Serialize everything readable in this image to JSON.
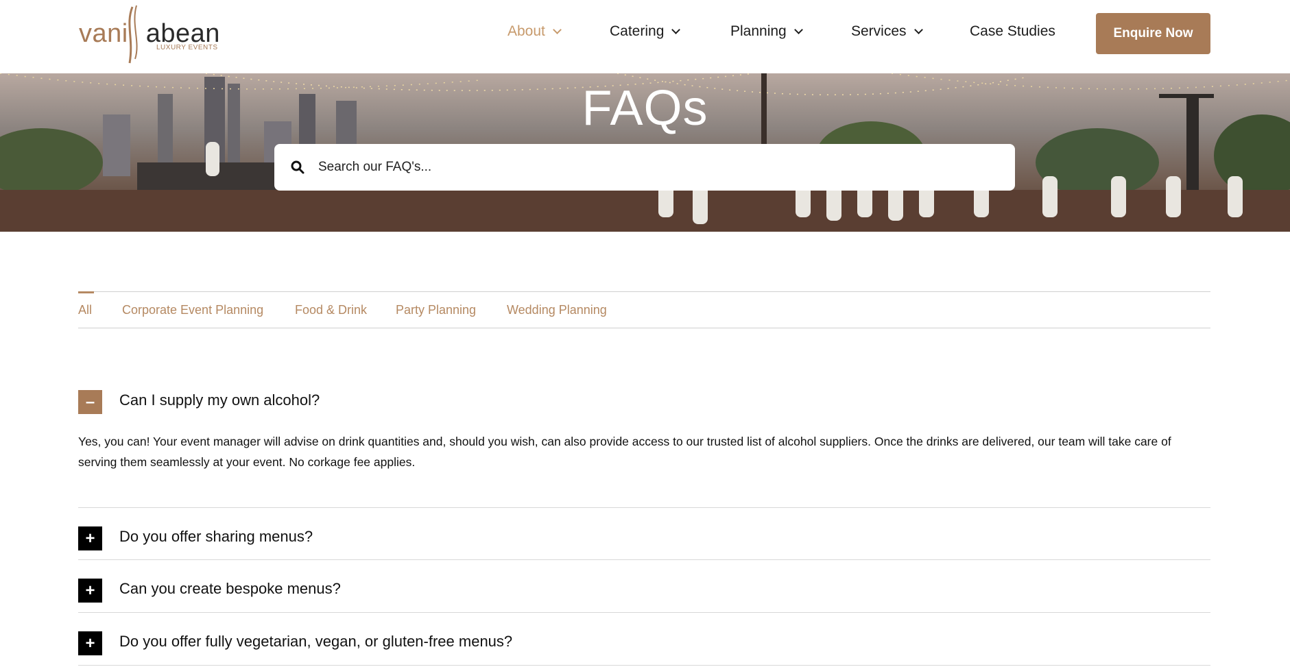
{
  "brand": {
    "logo_part1": "vani",
    "logo_part2": "abean",
    "tagline": "LUXURY EVENTS",
    "accent": "#a87b57",
    "nav_active": "#c79a6c"
  },
  "nav": {
    "items": [
      {
        "label": "About",
        "dropdown": true,
        "active": true
      },
      {
        "label": "Catering",
        "dropdown": true,
        "active": false
      },
      {
        "label": "Planning",
        "dropdown": true,
        "active": false
      },
      {
        "label": "Services",
        "dropdown": true,
        "active": false
      },
      {
        "label": "Case Studies",
        "dropdown": false,
        "active": false
      }
    ],
    "cta_label": "Enquire Now"
  },
  "hero": {
    "title": "FAQs",
    "search_placeholder": "Search our FAQ's...",
    "search_icon": "search-icon"
  },
  "tabs": [
    {
      "label": "All",
      "active": true
    },
    {
      "label": "Corporate Event Planning",
      "active": false
    },
    {
      "label": "Food & Drink",
      "active": false
    },
    {
      "label": "Party Planning",
      "active": false
    },
    {
      "label": "Wedding Planning",
      "active": false
    }
  ],
  "faqs": [
    {
      "question": "Can I supply my own alcohol?",
      "open": true,
      "toggle_symbol": "–",
      "answer": "Yes, you can! Your event manager will advise on drink quantities and, should you wish, can also provide access to our trusted list of alcohol suppliers. Once the drinks are delivered, our team will take care of serving them seamlessly at your event. No corkage fee applies."
    },
    {
      "question": "Do you offer sharing menus?",
      "open": false,
      "toggle_symbol": "+"
    },
    {
      "question": "Can you create bespoke menus?",
      "open": false,
      "toggle_symbol": "+"
    },
    {
      "question": "Do you offer fully vegetarian, vegan, or gluten-free menus?",
      "open": false,
      "toggle_symbol": "+"
    }
  ]
}
